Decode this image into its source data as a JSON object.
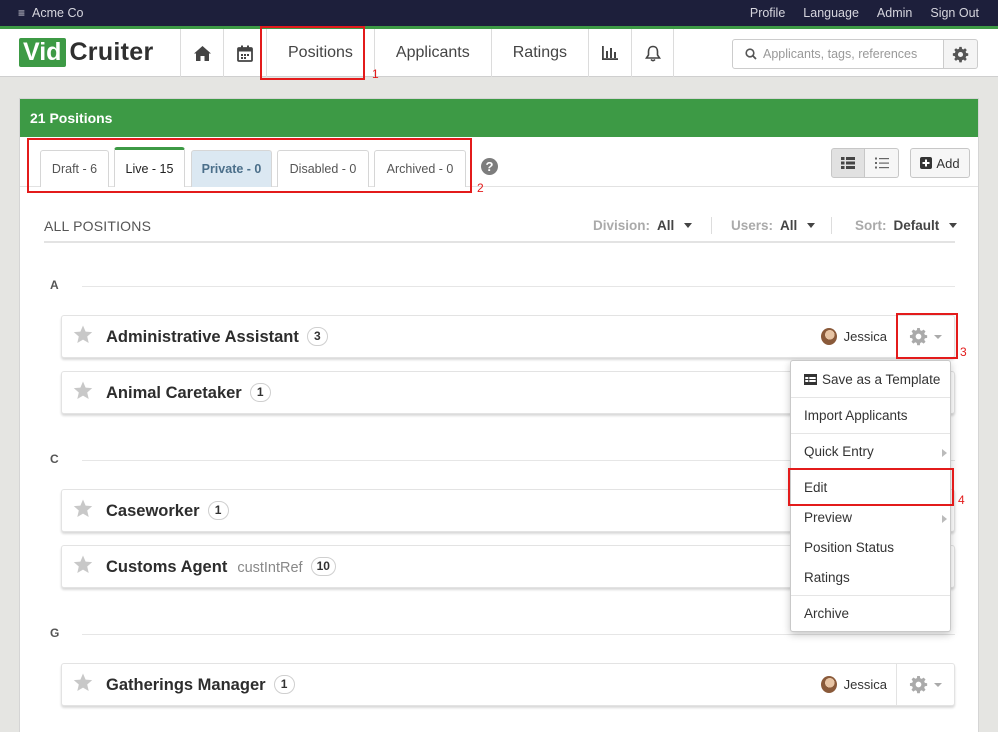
{
  "topbar": {
    "company": "Acme Co",
    "links": [
      "Profile",
      "Language",
      "Admin",
      "Sign Out"
    ]
  },
  "logo": {
    "part1": "Vid",
    "part2": "Cruiter"
  },
  "nav": {
    "positions": "Positions",
    "applicants": "Applicants",
    "ratings": "Ratings"
  },
  "search": {
    "placeholder": "Applicants, tags, references"
  },
  "panel": {
    "title": "21 Positions"
  },
  "tabs": [
    {
      "label": "Draft - 6"
    },
    {
      "label": "Live - 15"
    },
    {
      "label": "Private - 0"
    },
    {
      "label": "Disabled - 0"
    },
    {
      "label": "Archived - 0"
    }
  ],
  "toolbar": {
    "add_label": "Add",
    "help": "?"
  },
  "filters": {
    "heading": "ALL POSITIONS",
    "division_label": "Division:",
    "division_value": "All",
    "users_label": "Users:",
    "users_value": "All",
    "sort_label": "Sort:",
    "sort_value": "Default"
  },
  "groups": [
    {
      "letter": "A"
    },
    {
      "letter": "C"
    },
    {
      "letter": "G"
    }
  ],
  "positions": [
    {
      "title": "Administrative Assistant",
      "count": "3",
      "owner": "Jessica"
    },
    {
      "title": "Animal Caretaker",
      "count": "1"
    },
    {
      "title": "Caseworker",
      "count": "1"
    },
    {
      "title": "Customs Agent",
      "ref": "custIntRef",
      "count": "10"
    },
    {
      "title": "Gatherings Manager",
      "count": "1",
      "owner": "Jessica"
    }
  ],
  "menu": {
    "save_template": "Save as a Template",
    "import": "Import Applicants",
    "quick_entry": "Quick Entry",
    "edit": "Edit",
    "preview": "Preview",
    "status": "Position Status",
    "ratings": "Ratings",
    "archive": "Archive"
  },
  "annotations": [
    "1",
    "2",
    "3",
    "4"
  ],
  "colors": {
    "brand_green": "#3d9a45",
    "topbar": "#1d1f3b",
    "annotation_red": "#e31b1b"
  }
}
